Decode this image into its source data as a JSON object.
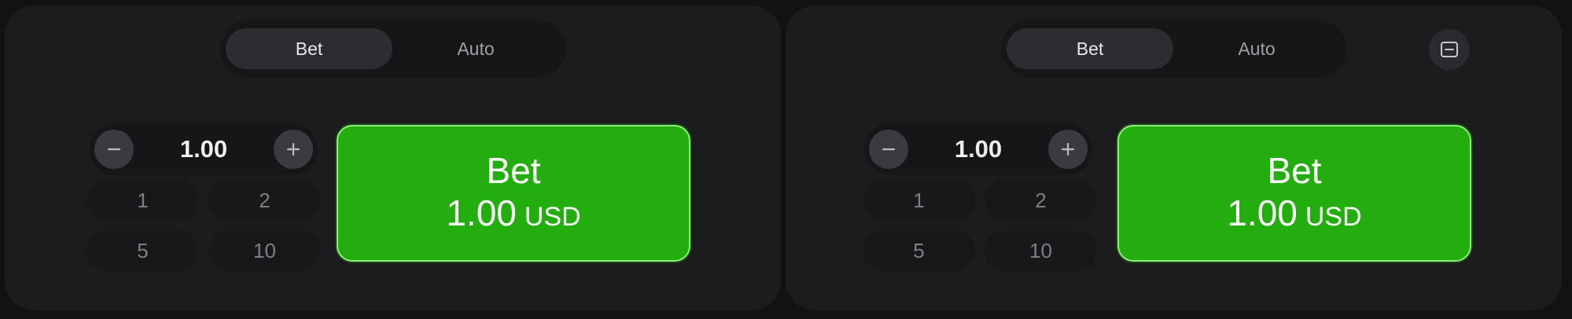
{
  "panels": [
    {
      "tabs": [
        {
          "label": "Bet",
          "active": true
        },
        {
          "label": "Auto",
          "active": false
        }
      ],
      "stepper": {
        "value": "1.00"
      },
      "chips": [
        "1",
        "2",
        "5",
        "10"
      ],
      "bet_button": {
        "title": "Bet",
        "amount": "1.00",
        "currency": "USD"
      }
    },
    {
      "tabs": [
        {
          "label": "Bet",
          "active": true
        },
        {
          "label": "Auto",
          "active": false
        }
      ],
      "stepper": {
        "value": "1.00"
      },
      "chips": [
        "1",
        "2",
        "5",
        "10"
      ],
      "bet_button": {
        "title": "Bet",
        "amount": "1.00",
        "currency": "USD"
      },
      "remove_panel_icon": "minus-square-icon"
    }
  ],
  "colors": {
    "page_bg": "#121214",
    "panel_bg": "#1c1c1f",
    "bet_green": "#24ad0f",
    "bet_border": "#8dee79"
  }
}
